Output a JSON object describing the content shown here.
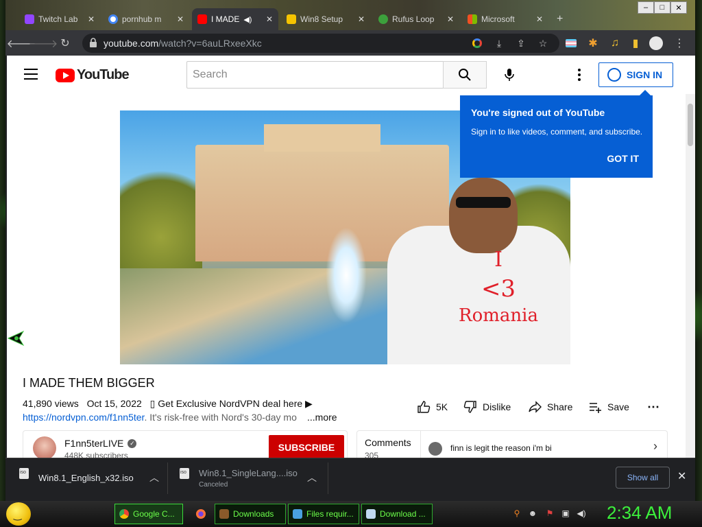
{
  "browser": {
    "tabs": [
      {
        "title": "Twitch Lab",
        "favicon_color": "#9146ff"
      },
      {
        "title": "pornhub m",
        "favicon_color": "#4285f4"
      },
      {
        "title": "I MADE",
        "favicon_color": "#ff0000",
        "active": true,
        "audio": true
      },
      {
        "title": "Win8 Setup",
        "favicon_color": "#f5c400"
      },
      {
        "title": "Rufus Loop",
        "favicon_color": "#3ca03c"
      },
      {
        "title": "Microsoft",
        "favicon_color": "#f25022"
      }
    ],
    "url_host": "youtube.com",
    "url_path": "/watch?v=6auLRxeeXkc"
  },
  "youtube": {
    "logo_text": "YouTube",
    "search_placeholder": "Search",
    "signin_label": "SIGN IN",
    "tooltip": {
      "title": "You're signed out of YouTube",
      "body": "Sign in to like videos, comment, and subscribe.",
      "button": "GOT IT"
    },
    "video": {
      "shirt_line1": "I",
      "shirt_line2": "<3",
      "shirt_line3": "Romania",
      "title": "I MADE THEM BIGGER",
      "views": "41,890 views",
      "date": "Oct 15, 2022",
      "promo": "▯ Get Exclusive NordVPN deal here ▶",
      "link": "https://nordvpn.com/f1nn5ter",
      "desc_tail": ". It's risk-free with Nord's 30-day mo",
      "more": "...more"
    },
    "actions": {
      "like": "5K",
      "dislike": "Dislike",
      "share": "Share",
      "save": "Save"
    },
    "channel": {
      "name": "F1nn5terLIVE",
      "subscribers": "448K subscribers",
      "subscribe_label": "SUBSCRIBE"
    },
    "comments": {
      "label": "Comments",
      "count": "305",
      "preview": "finn is legit the reason i'm bi"
    }
  },
  "downloads": {
    "items": [
      {
        "name": "Win8.1_English_x32.iso",
        "status": ""
      },
      {
        "name": "Win8.1_SingleLang....iso",
        "status": "Canceled"
      }
    ],
    "show_all": "Show all"
  },
  "taskbar": {
    "buttons": [
      {
        "label": "Google C...",
        "icon_color": "#4285f4"
      },
      {
        "label": "Downloads",
        "icon_color": "#8a5a2a"
      },
      {
        "label": "Files requir...",
        "icon_color": "#4aa0e0"
      },
      {
        "label": "Download ...",
        "icon_color": "#c0d8f0"
      }
    ],
    "clock": "2:34 AM"
  }
}
